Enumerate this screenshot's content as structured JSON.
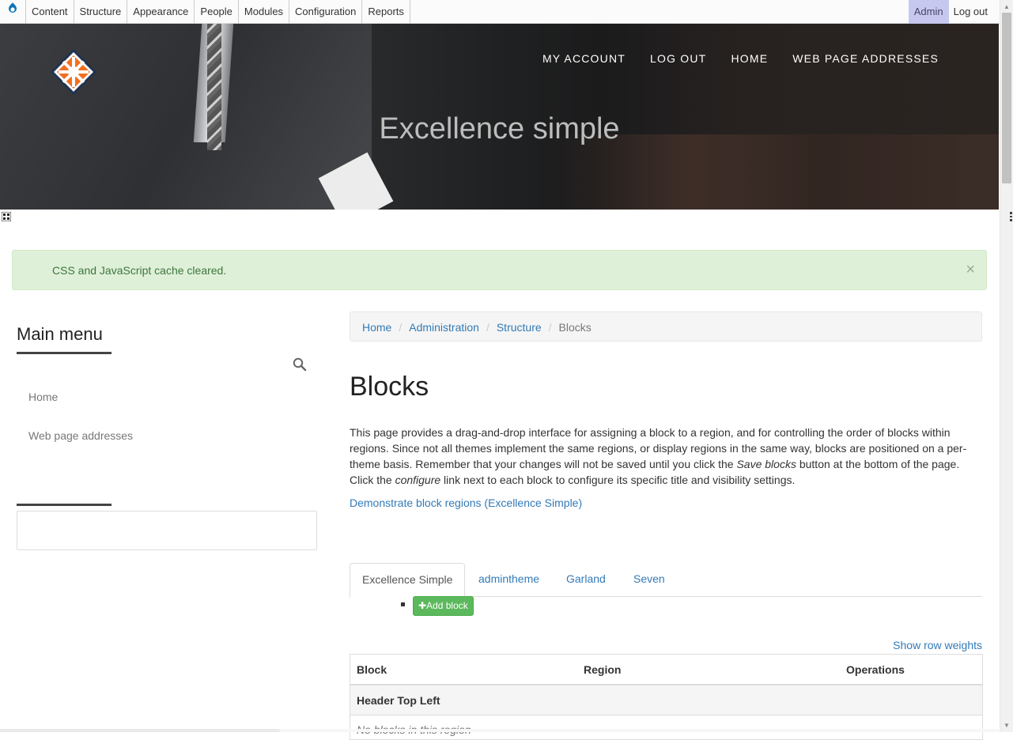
{
  "toolbar": {
    "items": [
      "Content",
      "Structure",
      "Appearance",
      "People",
      "Modules",
      "Configuration",
      "Reports"
    ],
    "user": "Admin",
    "logout": "Log out"
  },
  "header": {
    "nav": [
      "MY ACCOUNT",
      "LOG OUT",
      "HOME",
      "WEB PAGE ADDRESSES"
    ],
    "site_title": "Excellence simple"
  },
  "status": {
    "message": "CSS and JavaScript cache cleared.",
    "close": "×"
  },
  "sidebar": {
    "title": "Main menu",
    "items": [
      "Home",
      "Web page addresses"
    ]
  },
  "breadcrumb": {
    "links": [
      "Home",
      "Administration",
      "Structure"
    ],
    "current": "Blocks",
    "separator": "/"
  },
  "main": {
    "title": "Blocks",
    "desc_1": "This page provides a drag-and-drop interface for assigning a block to a region, and for controlling the order of blocks within regions. Since not all themes implement the same regions, or display regions in the same way, blocks are positioned on a per-theme basis. Remember that your changes will not be saved until you click the ",
    "desc_save": "Save blocks",
    "desc_2": " button at the bottom of the page. Click the ",
    "desc_configure": "configure",
    "desc_3": " link next to each block to configure its specific title and visibility settings.",
    "demo_link": "Demonstrate block regions (Excellence Simple)",
    "tabs": [
      "Excellence Simple",
      "admintheme",
      "Garland",
      "Seven"
    ],
    "add_block": "Add block",
    "show_weights": "Show row weights"
  },
  "table": {
    "headers": [
      "Block",
      "Region",
      "Operations"
    ],
    "region": "Header Top Left",
    "empty": "No blocks in this region"
  },
  "colors": {
    "link": "#337ab7",
    "success_bg": "#dff0d8",
    "success_text": "#3c763d",
    "button_green": "#5cb85c",
    "admin_highlight": "#c7c8f0"
  }
}
